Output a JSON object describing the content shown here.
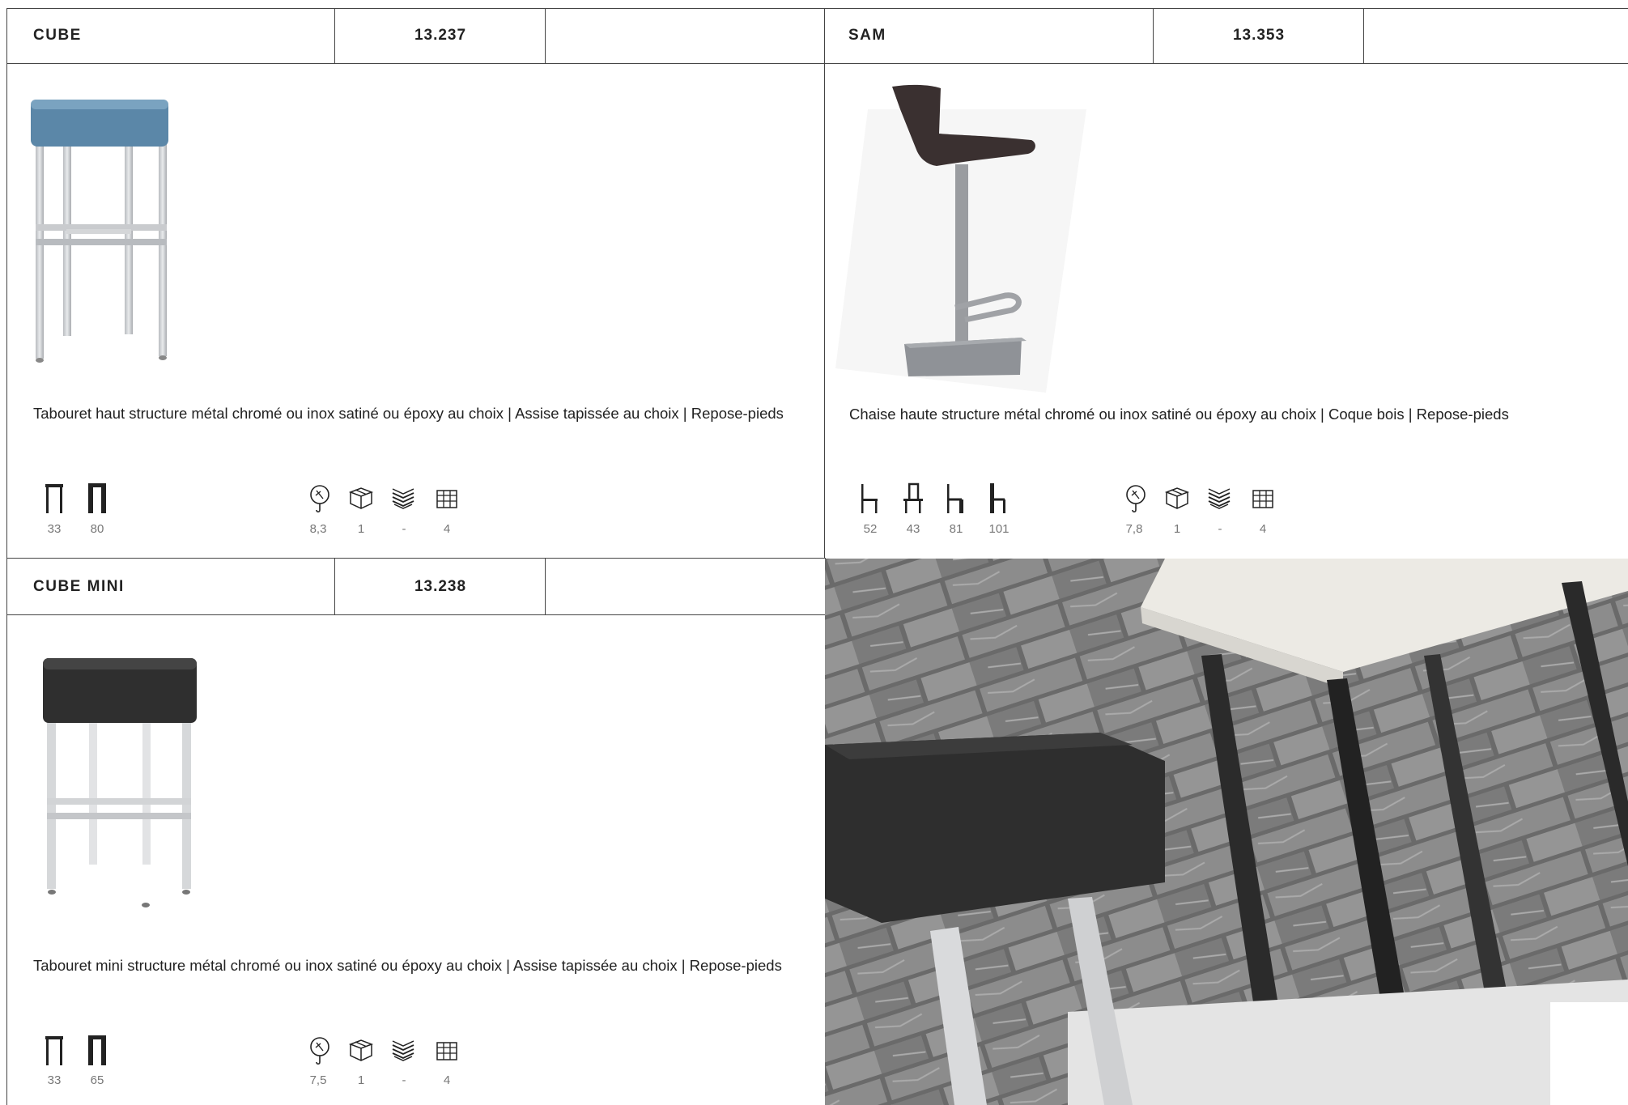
{
  "products": [
    {
      "name": "CUBE",
      "code": "13.237",
      "description": "Tabouret haut structure métal chromé ou inox satiné ou époxy au choix | Assise tapissée au choix | Repose-pieds",
      "dimensions": [
        "33",
        "80"
      ],
      "specs": [
        "8,3",
        "1",
        "-",
        "4"
      ]
    },
    {
      "name": "SAM",
      "code": "13.353",
      "description": "Chaise haute structure métal chromé ou inox satiné ou époxy au choix | Coque bois | Repose-pieds",
      "dimensions": [
        "52",
        "43",
        "81",
        "101"
      ],
      "specs": [
        "7,8",
        "1",
        "-",
        "4"
      ]
    },
    {
      "name": "CUBE MINI",
      "code": "13.238",
      "description": "Tabouret mini structure métal chromé ou inox satiné ou époxy au choix | Assise tapissée au choix | Repose-pieds",
      "dimensions": [
        "33",
        "65"
      ],
      "specs": [
        "7,5",
        "1",
        "-",
        "4"
      ]
    }
  ],
  "icons": {
    "dimensions": [
      "stool-width-icon",
      "stool-height-icon",
      "chair-seat-height-icon",
      "chair-total-height-icon"
    ],
    "specs": [
      "weight-icon",
      "box-icon",
      "stack-icon",
      "grid-icon"
    ]
  },
  "colors": {
    "border": "#444444",
    "text": "#222222",
    "muted": "#777777",
    "seat_blue": "#5b87a8",
    "seat_dark": "#2f2f2f"
  }
}
